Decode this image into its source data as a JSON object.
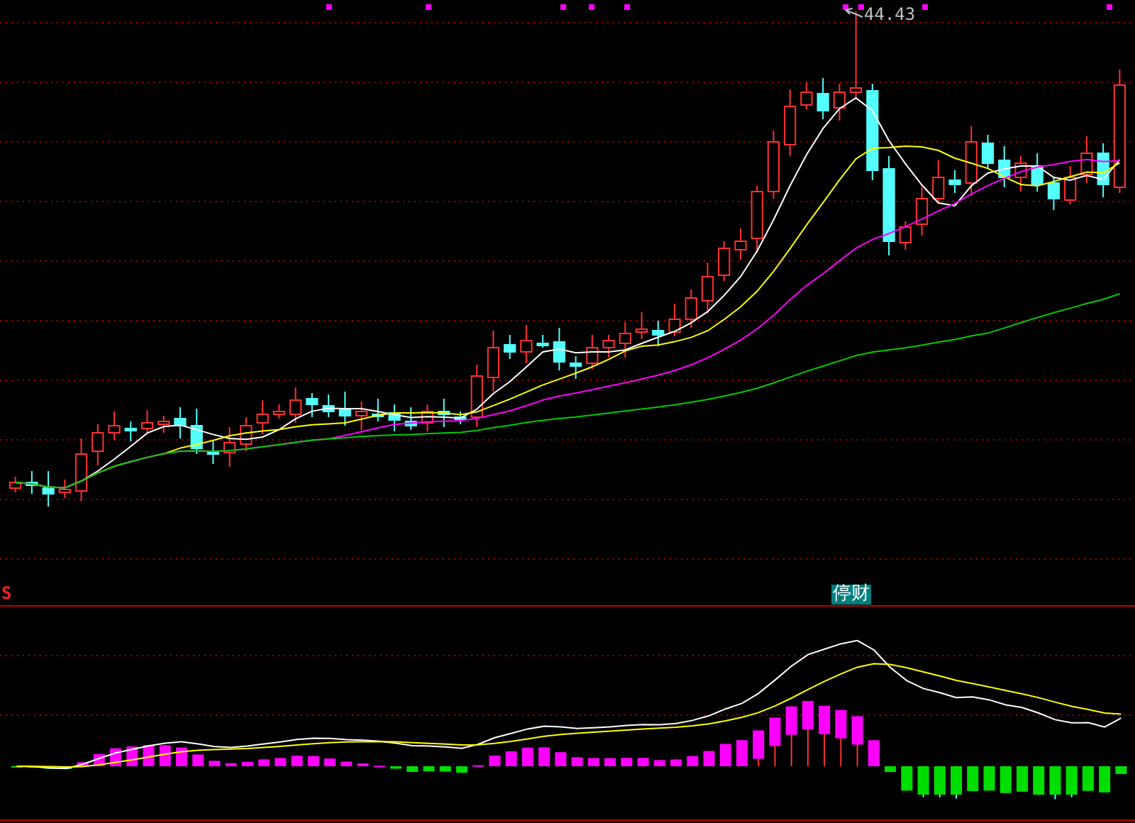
{
  "price_chart": {
    "peak_label": "44.43"
  },
  "indicator_panel": {
    "marker": "S",
    "badge": "停财"
  }
}
